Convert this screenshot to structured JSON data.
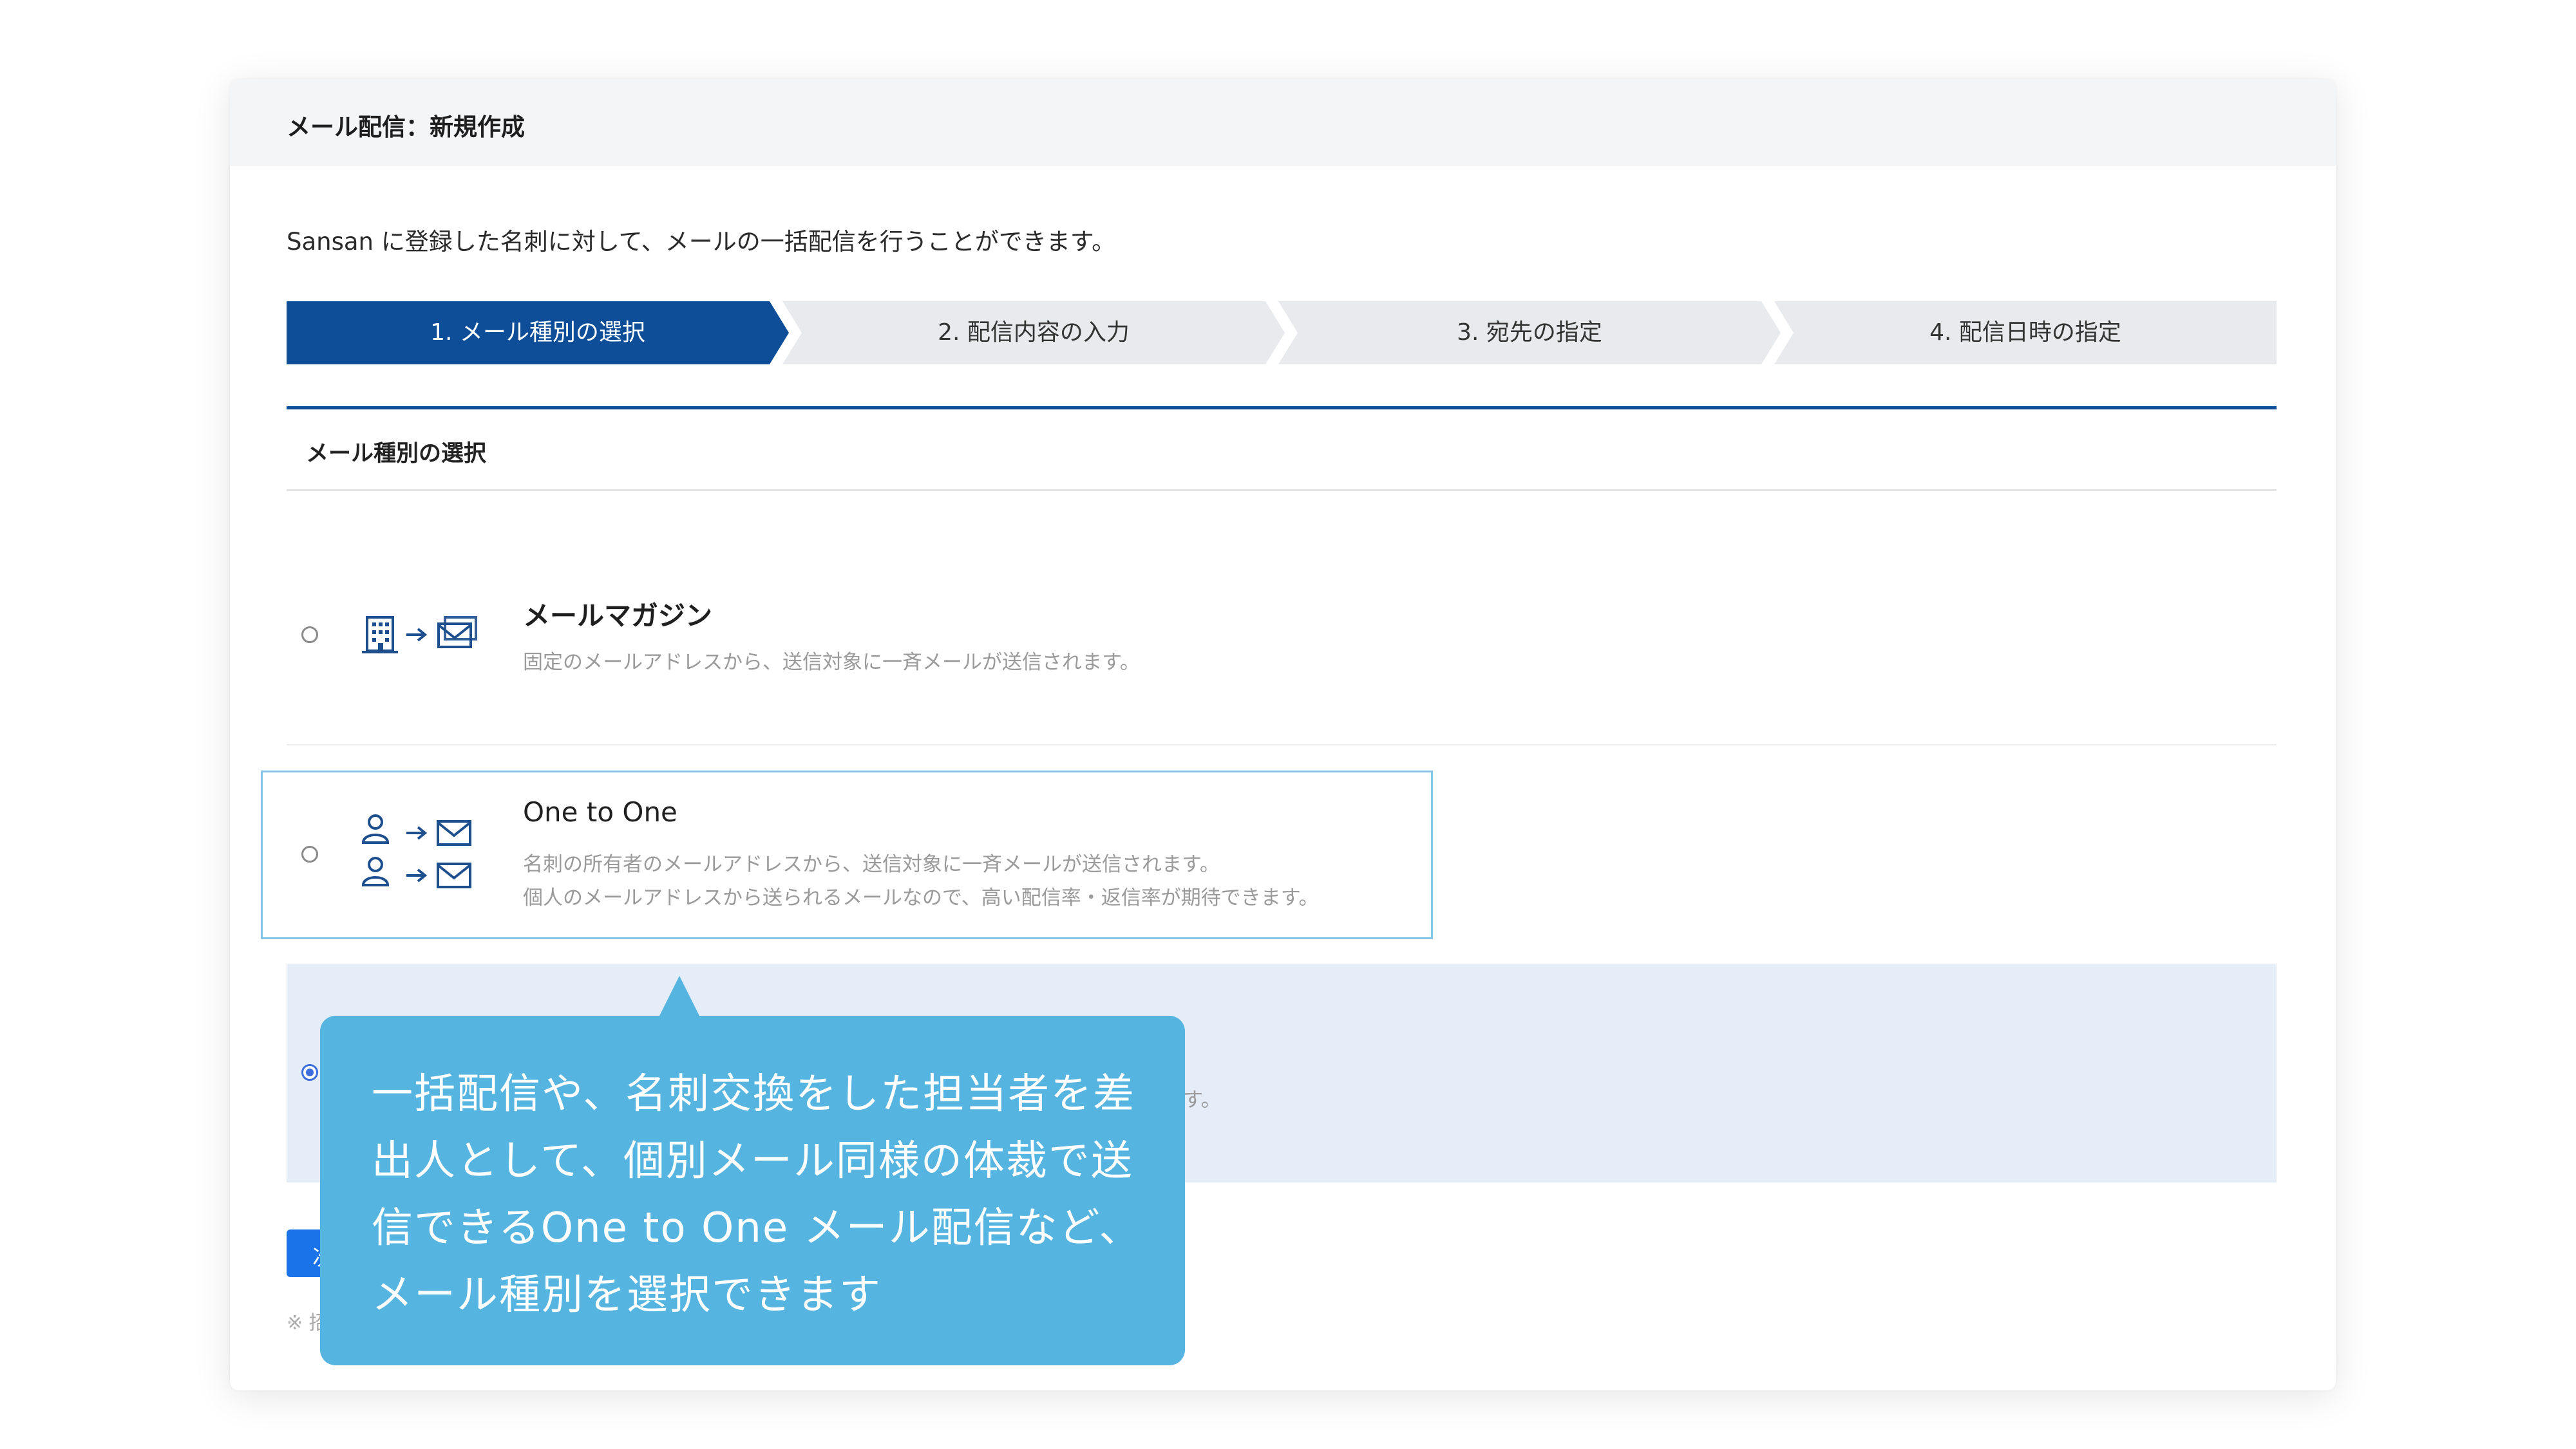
{
  "header": {
    "title": "メール配信：新規作成"
  },
  "intro": "Sansan に登録した名刺に対して、メールの一括配信を行うことができます。",
  "steps": [
    {
      "label": "1. メール種別の選択",
      "active": true
    },
    {
      "label": "2. 配信内容の入力",
      "active": false
    },
    {
      "label": "3. 宛先の指定",
      "active": false
    },
    {
      "label": "4. 配信日時の指定",
      "active": false
    }
  ],
  "section": {
    "title": "メール種別の選択"
  },
  "options": [
    {
      "title": "メールマガジン",
      "desc": [
        "固定のメールアドレスから、送信対象に一斉メールが送信されます。"
      ],
      "icons": [
        "building-icon",
        "arrow-right-icon",
        "mail-icon"
      ]
    },
    {
      "title": "One to One",
      "desc": [
        "名刺の所有者のメールアドレスから、送信対象に一斉メールが送信されます。",
        "個人のメールアドレスから送られるメールなので、高い配信率・返信率が期待できます。"
      ],
      "icons": [
        "person-icon",
        "arrow-right-icon",
        "mail-icon"
      ]
    }
  ],
  "third_option_visible_tail": "す。",
  "next_button_visible": "次",
  "note_visible": "※ 招",
  "tooltip": {
    "lines": [
      "一括配信や、名刺交換をした担当者を差",
      "出人として、個別メール同様の体裁で送",
      "信できるOne to One メール配信など、",
      "メール種別を選択できます"
    ]
  },
  "colors": {
    "step_active": "#0e4e99",
    "step_inactive": "#e8eaed",
    "tooltip_bg": "#55b4e0",
    "selected_bg": "#e4edf8",
    "selected_border": "#86c5ea",
    "icon": "#1d4f8f"
  }
}
